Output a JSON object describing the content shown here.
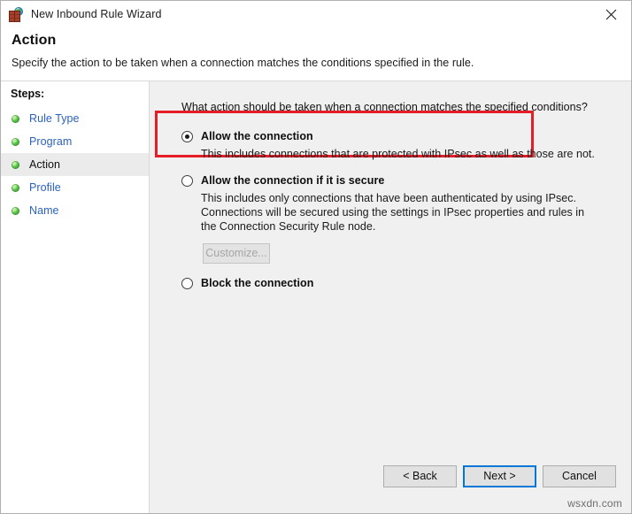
{
  "window": {
    "title": "New Inbound Rule Wizard",
    "app_icon": "firewall-globe-icon",
    "close_label": "close-icon"
  },
  "header": {
    "title": "Action",
    "subtitle": "Specify the action to be taken when a connection matches the conditions specified in the rule."
  },
  "sidebar": {
    "heading": "Steps:",
    "items": [
      {
        "label": "Rule Type",
        "current": false
      },
      {
        "label": "Program",
        "current": false
      },
      {
        "label": "Action",
        "current": true
      },
      {
        "label": "Profile",
        "current": false
      },
      {
        "label": "Name",
        "current": false
      }
    ]
  },
  "main": {
    "question": "What action should be taken when a connection matches the specified conditions?",
    "options": [
      {
        "title": "Allow the connection",
        "description": "This includes connections that are protected with IPsec as well as those are not.",
        "selected": true,
        "highlighted": true
      },
      {
        "title": "Allow the connection if it is secure",
        "description": "This includes only connections that have been authenticated by using IPsec.  Connections will be secured using the settings in IPsec properties and rules in the Connection Security Rule node.",
        "selected": false,
        "highlighted": false,
        "button": {
          "label": "Customize...",
          "disabled": true
        }
      },
      {
        "title": "Block the connection",
        "description": "",
        "selected": false,
        "highlighted": false
      }
    ]
  },
  "footer": {
    "back_label": "< Back",
    "next_label": "Next >",
    "cancel_label": "Cancel"
  },
  "watermark": "wsxdn.com",
  "colors": {
    "highlight_red": "#e51d26",
    "link_blue": "#2a62bf",
    "default_button_border": "#0078d7",
    "step_bullet_green": "#46b63c",
    "content_background": "#f0f0f0"
  }
}
